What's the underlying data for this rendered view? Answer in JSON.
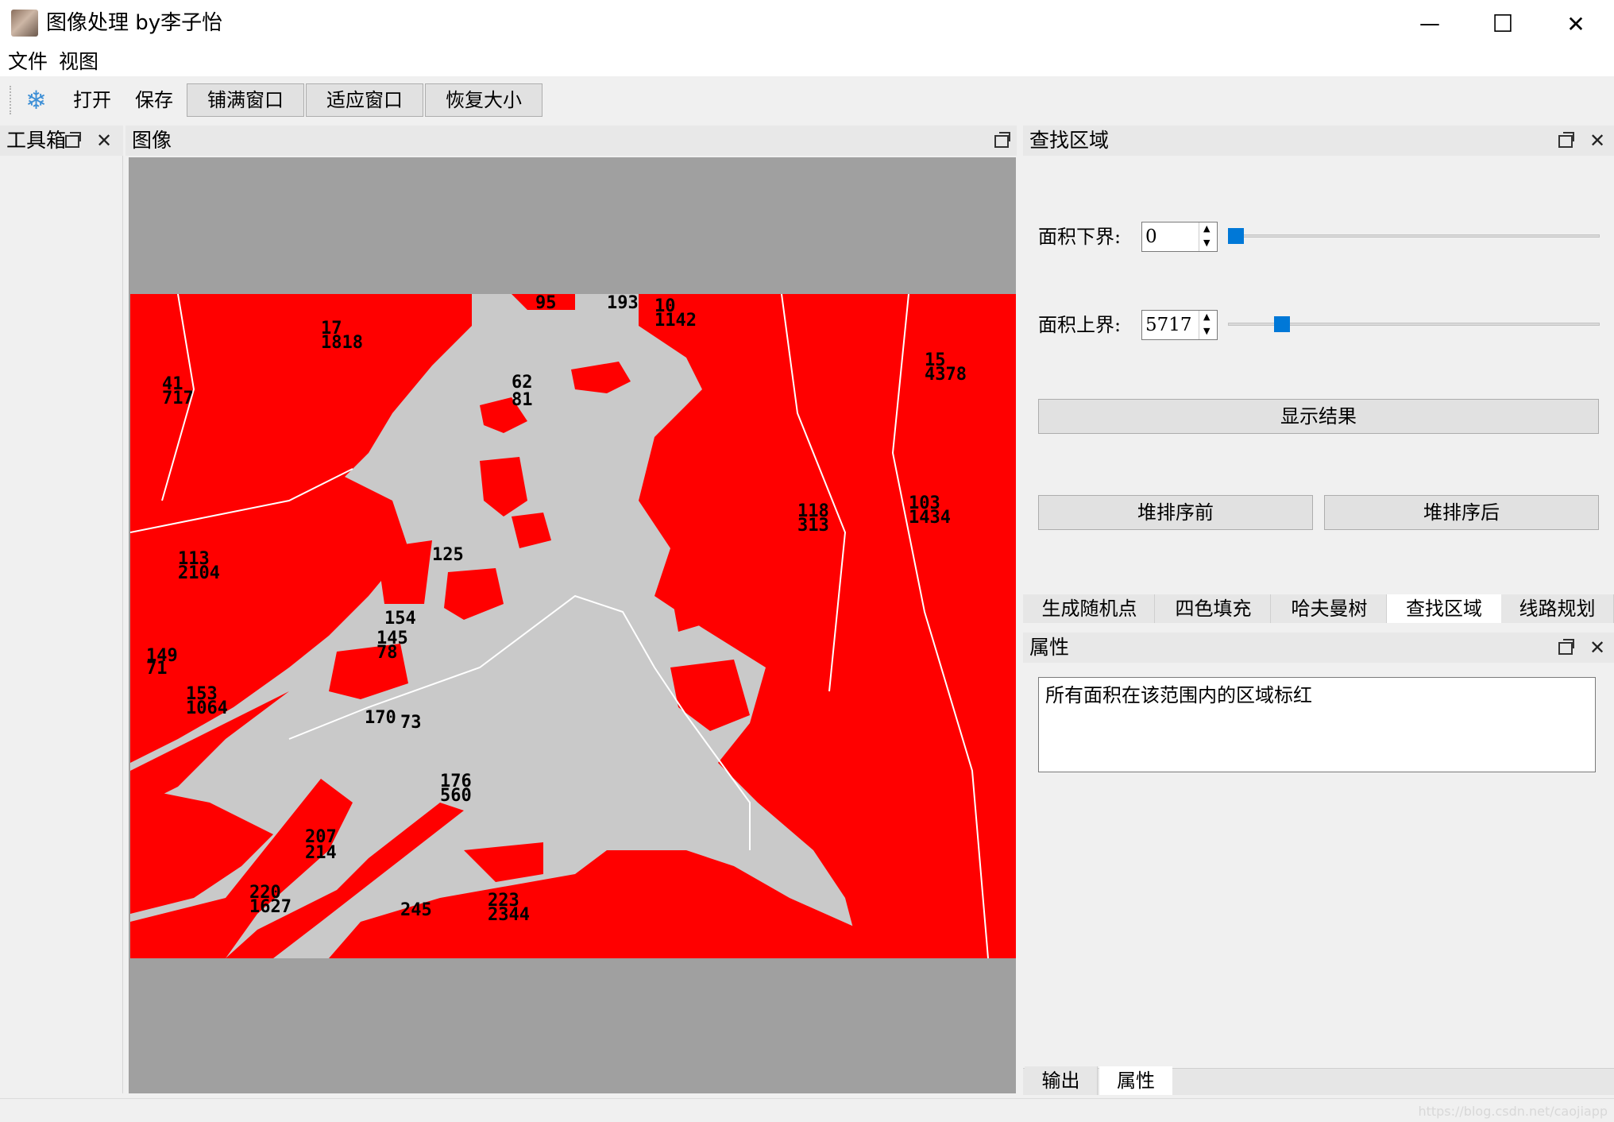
{
  "window": {
    "title": "图像处理 by李子怡",
    "minimize_glyph": "—",
    "maximize_glyph": "☐",
    "close_glyph": "✕"
  },
  "menubar": {
    "items": [
      "文件",
      "视图"
    ]
  },
  "toolbar": {
    "icon": "snowflake-icon",
    "icon_glyph": "❄",
    "open_label": "打开",
    "save_label": "保存",
    "fill_window_label": "铺满窗口",
    "fit_window_label": "适应窗口",
    "restore_size_label": "恢复大小"
  },
  "docks": {
    "toolbox": {
      "title": "工具箱"
    },
    "image": {
      "title": "图像"
    },
    "find_region": {
      "title": "查找区域",
      "area_lower_label": "面积下界:",
      "area_lower_value": "0",
      "area_lower_slider_fraction": 0.0,
      "area_upper_label": "面积上界:",
      "area_upper_value": "5717",
      "area_upper_slider_fraction": 0.13,
      "show_result_label": "显示结果",
      "before_heapsort_label": "堆排序前",
      "after_heapsort_label": "堆排序后"
    },
    "feature_tabs": [
      "生成随机点",
      "四色填充",
      "哈夫曼树",
      "查找区域",
      "线路规划"
    ],
    "feature_tab_active": "查找区域",
    "properties": {
      "title": "属性",
      "text": "所有面积在该范围内的区域标红"
    },
    "bottom_tabs": [
      "输出",
      "属性"
    ],
    "bottom_tab_active": "属性"
  },
  "map_labels": [
    "95",
    "193",
    "10",
    "1142",
    "15",
    "4378",
    "62",
    "81",
    "103",
    "1434",
    "113",
    "2104",
    "125",
    "154",
    "170",
    "73",
    "207",
    "214",
    "220",
    "1627",
    "223",
    "2344",
    "245",
    "17",
    "1818",
    "41",
    "717",
    "145",
    "78",
    "149",
    "71",
    "153",
    "1064",
    "176",
    "560",
    "118",
    "313"
  ],
  "colors": {
    "highlight_region": "#ff0000",
    "other_region": "#c9c9c9",
    "accent": "#0078d7"
  },
  "watermark": "https://blog.csdn.net/caojiapp"
}
